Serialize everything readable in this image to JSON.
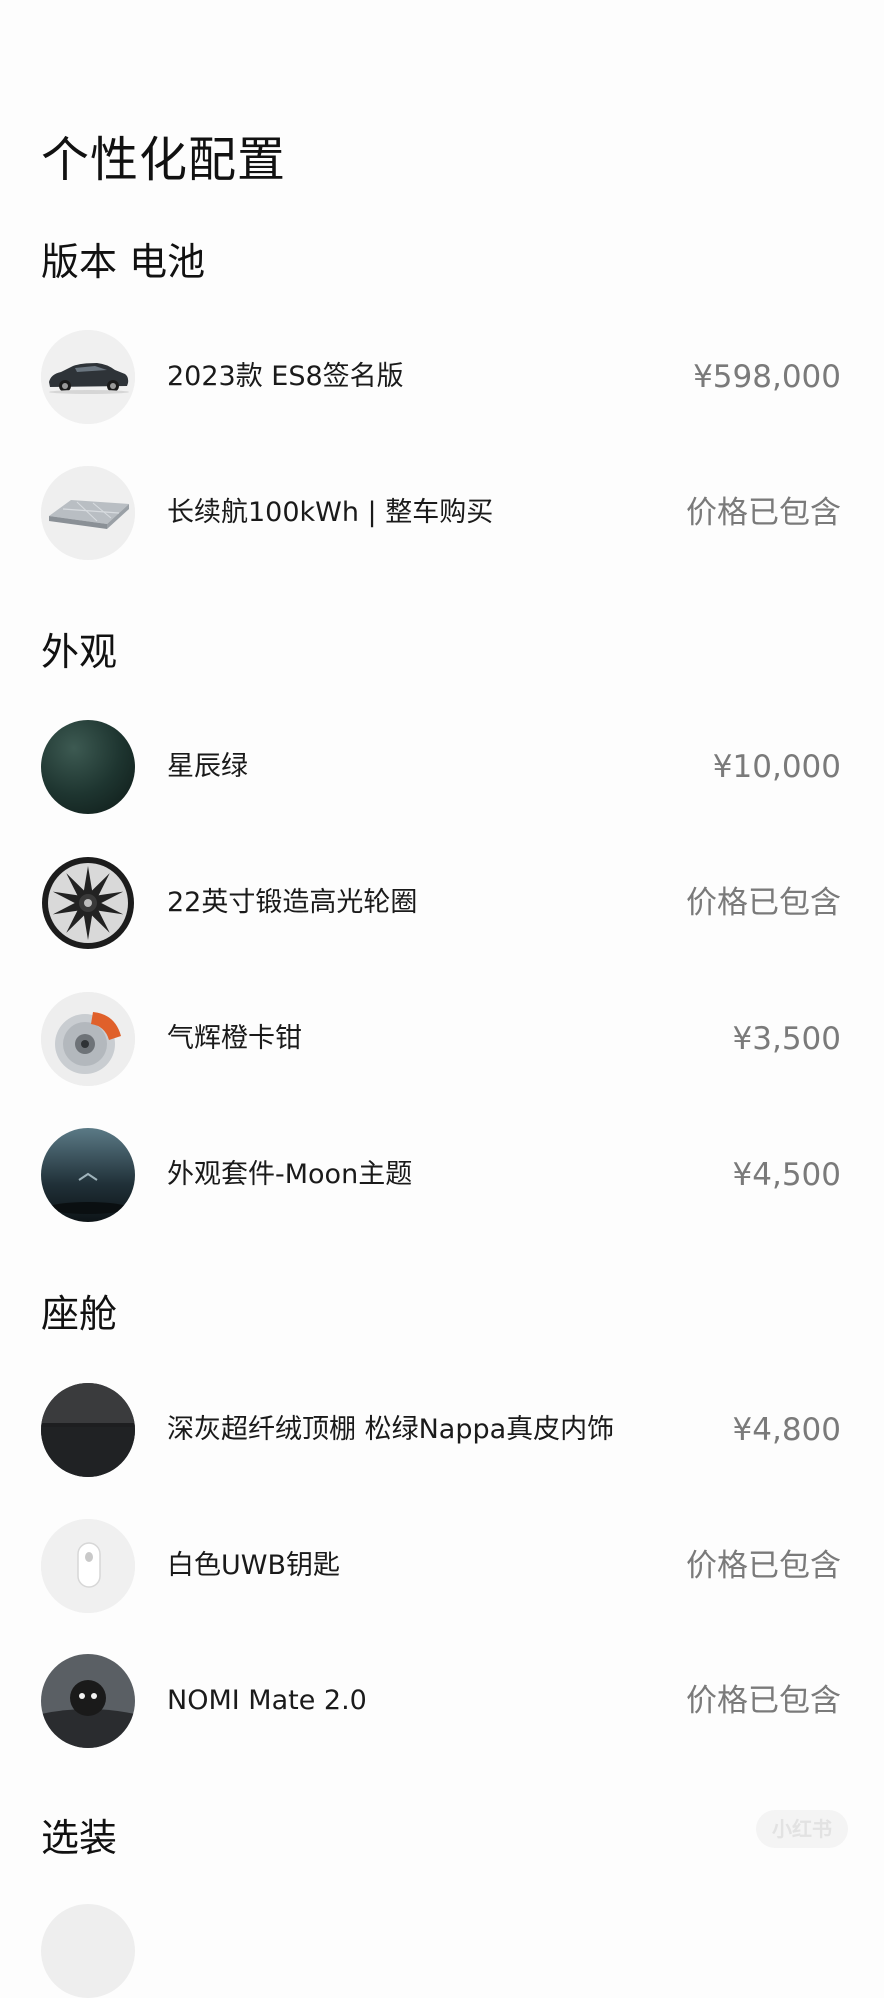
{
  "page": {
    "title": "个性化配置"
  },
  "sections": {
    "version": {
      "title": "版本 电池",
      "items": [
        {
          "name": "2023款 ES8签名版",
          "price": "¥598,000",
          "icon": "car-icon"
        },
        {
          "name": "长续航100kWh | 整车购买",
          "price": "价格已包含",
          "icon": "battery-pack-icon"
        }
      ]
    },
    "exterior": {
      "title": "外观",
      "items": [
        {
          "name": "星辰绿",
          "price": "¥10,000",
          "icon": "paint-color-swatch-icon"
        },
        {
          "name": "22英寸锻造高光轮圈",
          "price": "价格已包含",
          "icon": "wheel-rim-icon"
        },
        {
          "name": "气辉橙卡钳",
          "price": "¥3,500",
          "icon": "brake-caliper-icon"
        },
        {
          "name": "外观套件-Moon主题",
          "price": "¥4,500",
          "icon": "moon-theme-icon"
        }
      ]
    },
    "cabin": {
      "title": "座舱",
      "items": [
        {
          "name": "深灰超纤绒顶棚 松绿Nappa真皮内饰",
          "price": "¥4,800",
          "icon": "interior-trim-icon"
        },
        {
          "name": "白色UWB钥匙",
          "price": "价格已包含",
          "icon": "uwb-key-icon"
        },
        {
          "name": "NOMI Mate 2.0",
          "price": "价格已包含",
          "icon": "nomi-robot-icon"
        }
      ]
    },
    "options": {
      "title": "选装"
    }
  },
  "watermark": "小红书",
  "colors": {
    "title_text": "#111111",
    "price_text": "#7a7a7a",
    "paint_green": "#1e3530",
    "caliper_orange": "#e0602a"
  }
}
